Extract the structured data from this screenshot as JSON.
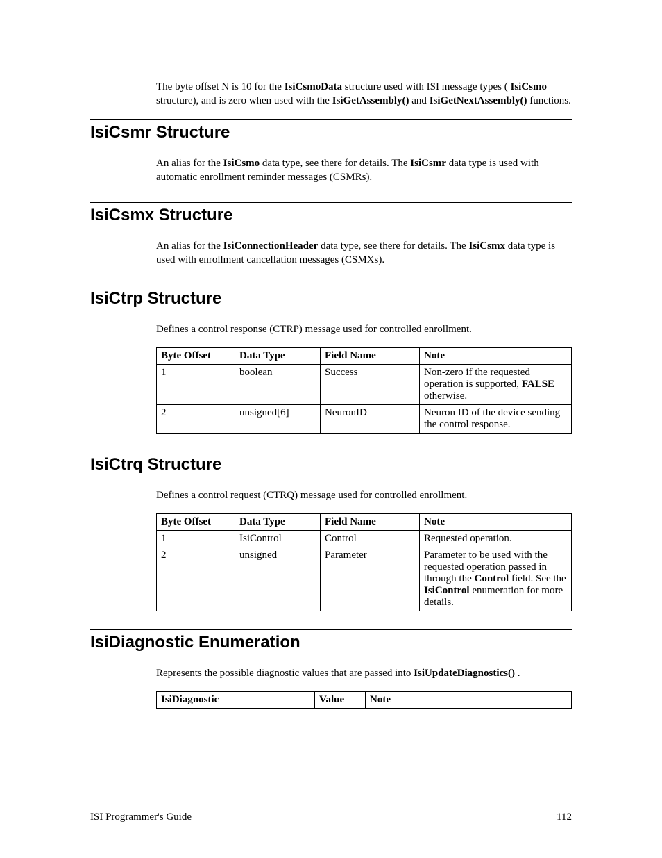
{
  "intro": {
    "pre": "The byte offset N is 10 for the ",
    "b1": "IsiCsmoData",
    "mid1": " structure used with ISI message types (",
    "b2": "IsiCsmo",
    "mid2": " structure), and is zero when used with the ",
    "b3": "IsiGetAssembly()",
    "mid3": " and ",
    "b4": "IsiGetNextAssembly()",
    "post": " functions."
  },
  "csmr": {
    "heading": "IsiCsmr Structure",
    "para": {
      "pre": "An alias for the ",
      "b1": "IsiCsmo",
      "mid1": " data type, see there for details.  The ",
      "b2": "IsiCsmr",
      "post": " data type is used with automatic enrollment reminder messages (CSMRs)."
    }
  },
  "csmx": {
    "heading": "IsiCsmx Structure",
    "para": {
      "pre": "An alias for the ",
      "b1": "IsiConnectionHeader",
      "mid1": " data type, see there for details.  The ",
      "b2": "IsiCsmx",
      "post": " data type is used with enrollment cancellation messages (CSMXs)."
    }
  },
  "ctrp": {
    "heading": "IsiCtrp Structure",
    "desc": "Defines a control response (CTRP) message used for controlled enrollment.",
    "headers": {
      "c0": "Byte Offset",
      "c1": "Data Type",
      "c2": "Field Name",
      "c3": "Note"
    },
    "rows": [
      {
        "offset": "1",
        "type": "boolean",
        "name": "Success",
        "note_pre": "Non-zero if the requested operation is supported, ",
        "note_b": "FALSE",
        "note_post": " otherwise."
      },
      {
        "offset": "2",
        "type": "unsigned[6]",
        "name": "NeuronID",
        "note_pre": "Neuron ID of the device sending the control response.",
        "note_b": "",
        "note_post": ""
      }
    ]
  },
  "ctrq": {
    "heading": "IsiCtrq Structure",
    "desc": "Defines a control request (CTRQ) message used for controlled enrollment.",
    "headers": {
      "c0": "Byte Offset",
      "c1": "Data Type",
      "c2": "Field Name",
      "c3": "Note"
    },
    "rows": [
      {
        "offset": "1",
        "type": "IsiControl",
        "name": "Control",
        "note_pre": "Requested operation.",
        "note_b1": "",
        "note_mid": "",
        "note_b2": "",
        "note_post": ""
      },
      {
        "offset": "2",
        "type": "unsigned",
        "name": "Parameter",
        "note_pre": "Parameter to be used with the requested operation passed in through the ",
        "note_b1": "Control",
        "note_mid": " field.  See the ",
        "note_b2": "IsiControl",
        "note_post": " enumeration for more details."
      }
    ]
  },
  "diag": {
    "heading": "IsiDiagnostic Enumeration",
    "para": {
      "pre": "Represents the possible diagnostic values that are passed into ",
      "b1": "IsiUpdateDiagnostics()",
      "post": "."
    },
    "headers": {
      "c0": "IsiDiagnostic",
      "c1": "Value",
      "c2": "Note"
    }
  },
  "footer": {
    "left": "ISI Programmer's Guide",
    "right": "112"
  }
}
